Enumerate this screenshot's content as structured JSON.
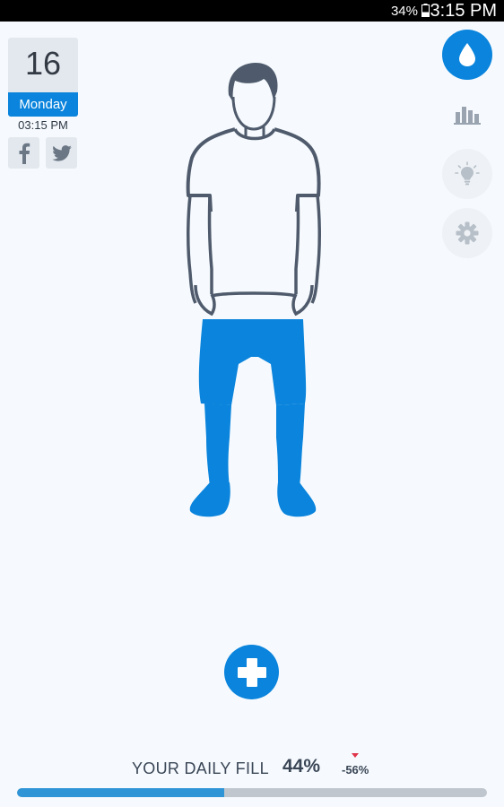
{
  "status_bar": {
    "battery_percent": "34%",
    "time": "3:15 PM",
    "icons": [
      "battery-icon"
    ]
  },
  "date_card": {
    "day": "16",
    "weekday": "Monday",
    "time": "03:15 PM"
  },
  "social": {
    "facebook_glyph": "f",
    "icons": [
      "facebook-icon",
      "twitter-icon"
    ]
  },
  "rail": {
    "icons": [
      "water-drop-icon",
      "bar-chart-icon",
      "lightbulb-icon",
      "gear-icon"
    ],
    "active": "water-drop-icon"
  },
  "figure": {
    "icons": [
      "person-silhouette"
    ],
    "fill_color": "#0a84dc",
    "outline_color": "#4f5b6c"
  },
  "add_button": {
    "icon": "plus-icon"
  },
  "daily_fill": {
    "label": "YOUR DAILY FILL",
    "value": "44%",
    "progress": 0.44,
    "delta": "-56%",
    "delta_direction": "down"
  },
  "colors": {
    "accent": "#0a84dc",
    "background": "#f6fafe",
    "progress_fill": "#2f95d6",
    "progress_track": "#bfc6ce",
    "delta_indicator": "#e0344a"
  }
}
